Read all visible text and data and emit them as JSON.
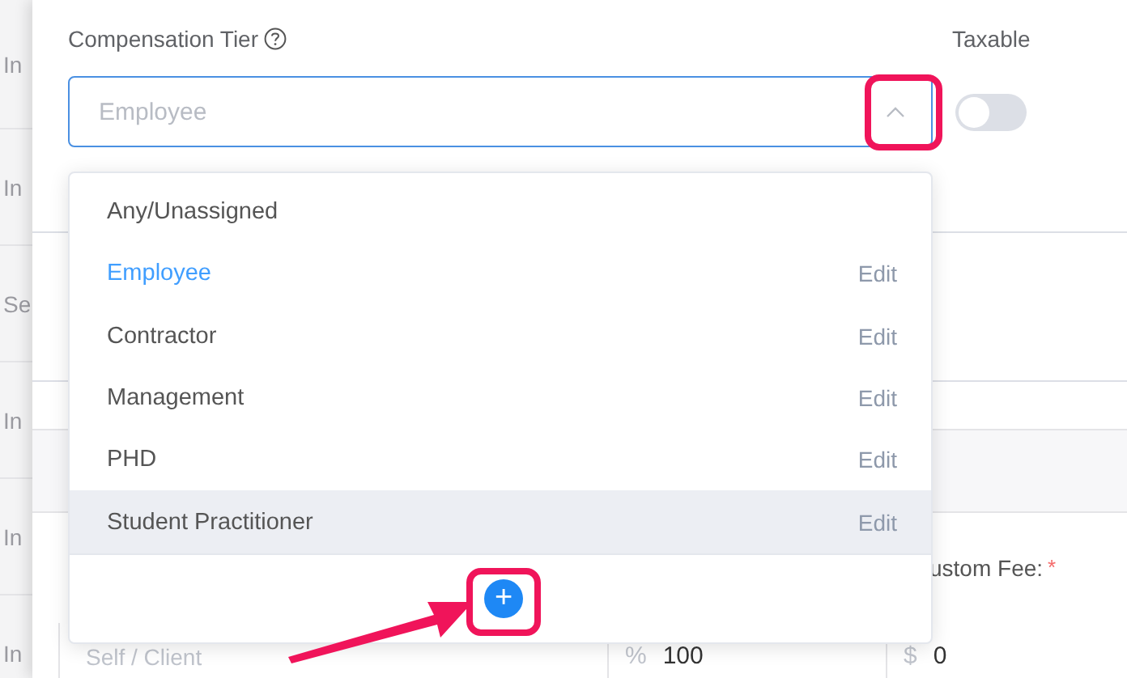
{
  "background_rows": [
    {
      "text": "In"
    },
    {
      "text": "In"
    },
    {
      "text": "Se"
    },
    {
      "text": "In"
    },
    {
      "text": "In"
    },
    {
      "text": "In"
    }
  ],
  "compensation_tier": {
    "label": "Compensation Tier",
    "placeholder": "Employee",
    "expanded": true
  },
  "taxable": {
    "label": "Taxable",
    "on": false
  },
  "dropdown": {
    "options": [
      {
        "label": "Any/Unassigned",
        "selected": false,
        "hovered": false
      },
      {
        "label": "Employee",
        "selected": true,
        "hovered": false,
        "action": "Edit"
      },
      {
        "label": "Contractor",
        "selected": false,
        "hovered": false,
        "action": "Edit"
      },
      {
        "label": "Management",
        "selected": false,
        "hovered": false,
        "action": "Edit"
      },
      {
        "label": "PHD",
        "selected": false,
        "hovered": false,
        "action": "Edit"
      },
      {
        "label": "Student Practitioner",
        "selected": false,
        "hovered": true,
        "action": "Edit"
      }
    ],
    "add_button": "+"
  },
  "custom_fee": {
    "label": "ustom Fee:",
    "required_mark": "*",
    "currency": "$",
    "value": "0"
  },
  "split": {
    "select_value": "Self / Client",
    "percent_symbol": "%",
    "percent_value": "100"
  }
}
